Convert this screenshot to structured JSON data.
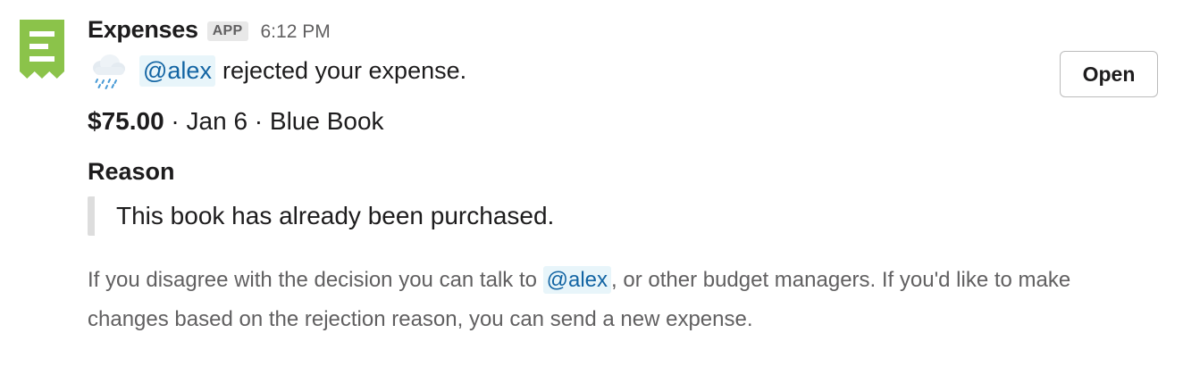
{
  "message": {
    "sender": "Expenses",
    "badge": "APP",
    "timestamp": "6:12 PM",
    "icon": "receipt-icon",
    "status_emoji": "rain-cloud-icon",
    "mention": "@alex",
    "action_text": "rejected your expense.",
    "expense": {
      "amount": "$75.00",
      "details": " · Jan 6 · Blue Book"
    },
    "reason_title": "Reason",
    "reason_text": "This book has already been purchased.",
    "footer": {
      "before_mention": "If you disagree with the decision you can talk to ",
      "mention": "@alex",
      "after_mention": ", or other budget managers. If you'd like to make changes based on the rejection reason, you can send a new expense."
    },
    "open_button_label": "Open"
  },
  "colors": {
    "brand_green": "#8bc34a",
    "mention_text": "#1264a3",
    "mention_bg": "#e8f5fa",
    "muted_text": "#616061"
  }
}
